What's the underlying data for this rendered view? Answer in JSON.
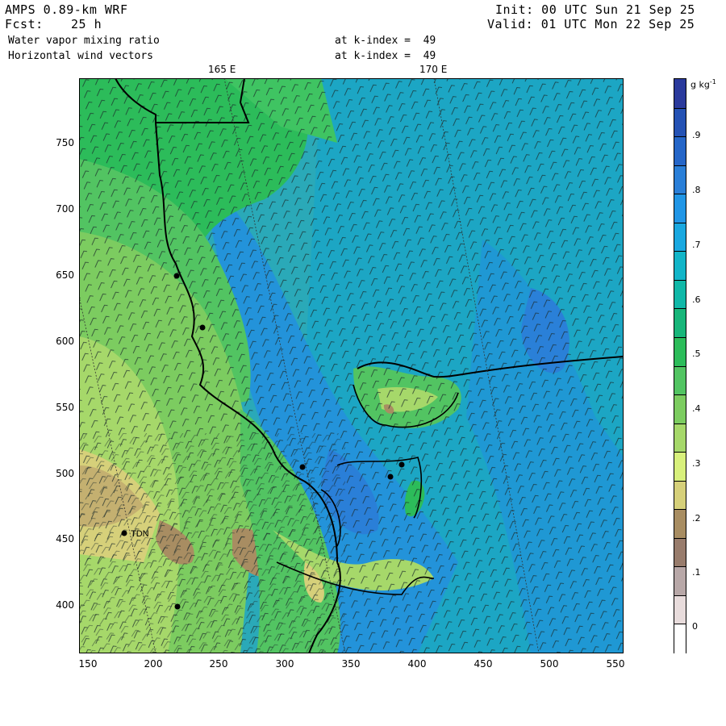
{
  "header": {
    "model": "AMPS 0.89-km WRF",
    "fcst_label": "Fcst:",
    "fcst_value": "25 h",
    "init": "Init: 00 UTC Sun 21 Sep 25",
    "valid": "Valid: 01 UTC Mon 22 Sep 25",
    "field1": "Water vapor mixing ratio",
    "field1_level": "at k-index =  49",
    "field2": "Horizontal wind vectors",
    "field2_level": "at k-index =  49"
  },
  "map": {
    "longitude_labels": [
      "165 E",
      "170 E"
    ],
    "station_label": "TDN",
    "x_ticks": [
      "150",
      "200",
      "250",
      "300",
      "350",
      "400",
      "450",
      "500",
      "550"
    ],
    "y_ticks": [
      "750",
      "700",
      "650",
      "600",
      "550",
      "500",
      "450",
      "400"
    ],
    "x_range": [
      145,
      557
    ],
    "y_range": [
      363,
      798
    ]
  },
  "colorbar": {
    "unit": "g kg",
    "unit_exponent": "-1",
    "labels": [
      ".9",
      ".8",
      ".7",
      ".6",
      ".5",
      ".4",
      ".3",
      ".2",
      ".1",
      "0"
    ],
    "colors_top_to_bottom": [
      "#2a3a9c",
      "#2452b4",
      "#2566c8",
      "#2a7fd8",
      "#2196e6",
      "#1aa8e0",
      "#12b5c8",
      "#10b8a8",
      "#18b67a",
      "#2cbc5a",
      "#52c462",
      "#7ccc60",
      "#a6d86a",
      "#d8f07c",
      "#d6d07a",
      "#a88d62",
      "#987c6c",
      "#b8a8a8",
      "#e8dcdc",
      "#ffffff"
    ]
  }
}
